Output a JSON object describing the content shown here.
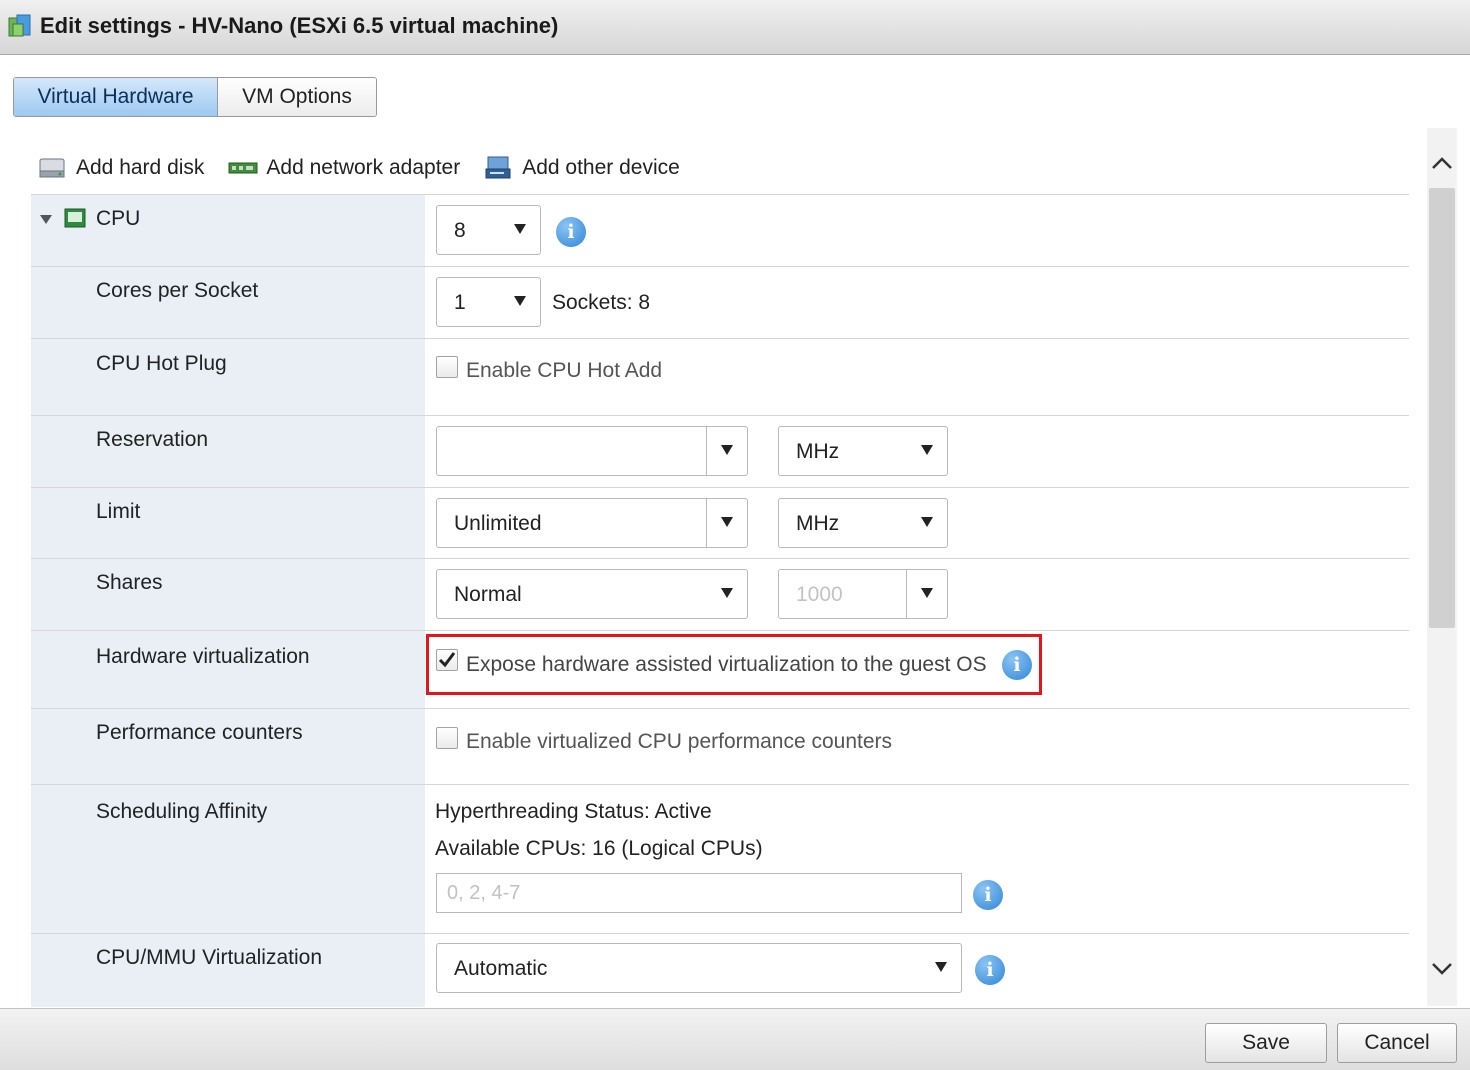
{
  "window": {
    "title": "Edit settings - HV-Nano (ESXi 6.5 virtual machine)"
  },
  "tabs": [
    {
      "label": "Virtual Hardware",
      "active": true
    },
    {
      "label": "VM Options",
      "active": false
    }
  ],
  "toolbar": {
    "add_hard_disk": "Add hard disk",
    "add_network_adapter": "Add network adapter",
    "add_other_device": "Add other device"
  },
  "cpu": {
    "section_label": "CPU",
    "count": "8",
    "cores_per_socket": {
      "label": "Cores per Socket",
      "value": "1",
      "sockets_text": "Sockets: 8"
    },
    "hot_plug": {
      "label": "CPU Hot Plug",
      "checkbox_label": "Enable CPU Hot Add",
      "checked": false
    },
    "reservation": {
      "label": "Reservation",
      "value": "",
      "unit": "MHz"
    },
    "limit": {
      "label": "Limit",
      "value": "Unlimited",
      "unit": "MHz"
    },
    "shares": {
      "label": "Shares",
      "value": "Normal",
      "amount": "1000"
    },
    "hardware_virtualization": {
      "label": "Hardware virtualization",
      "checkbox_label": "Expose hardware assisted virtualization to the guest OS",
      "checked": true
    },
    "performance_counters": {
      "label": "Performance counters",
      "checkbox_label": "Enable virtualized CPU performance counters",
      "checked": false
    },
    "scheduling_affinity": {
      "label": "Scheduling Affinity",
      "hyperthreading": "Hyperthreading Status: Active",
      "available_cpus": "Available CPUs: 16 (Logical CPUs)",
      "placeholder": "0, 2, 4-7"
    },
    "mmu_virtualization": {
      "label": "CPU/MMU Virtualization",
      "value": "Automatic"
    }
  },
  "info_glyph": "i",
  "footer": {
    "save": "Save",
    "cancel": "Cancel"
  },
  "colors": {
    "highlight": "#e5161b",
    "active_tab": "#9ec9f1",
    "info": "#2f86d6"
  }
}
